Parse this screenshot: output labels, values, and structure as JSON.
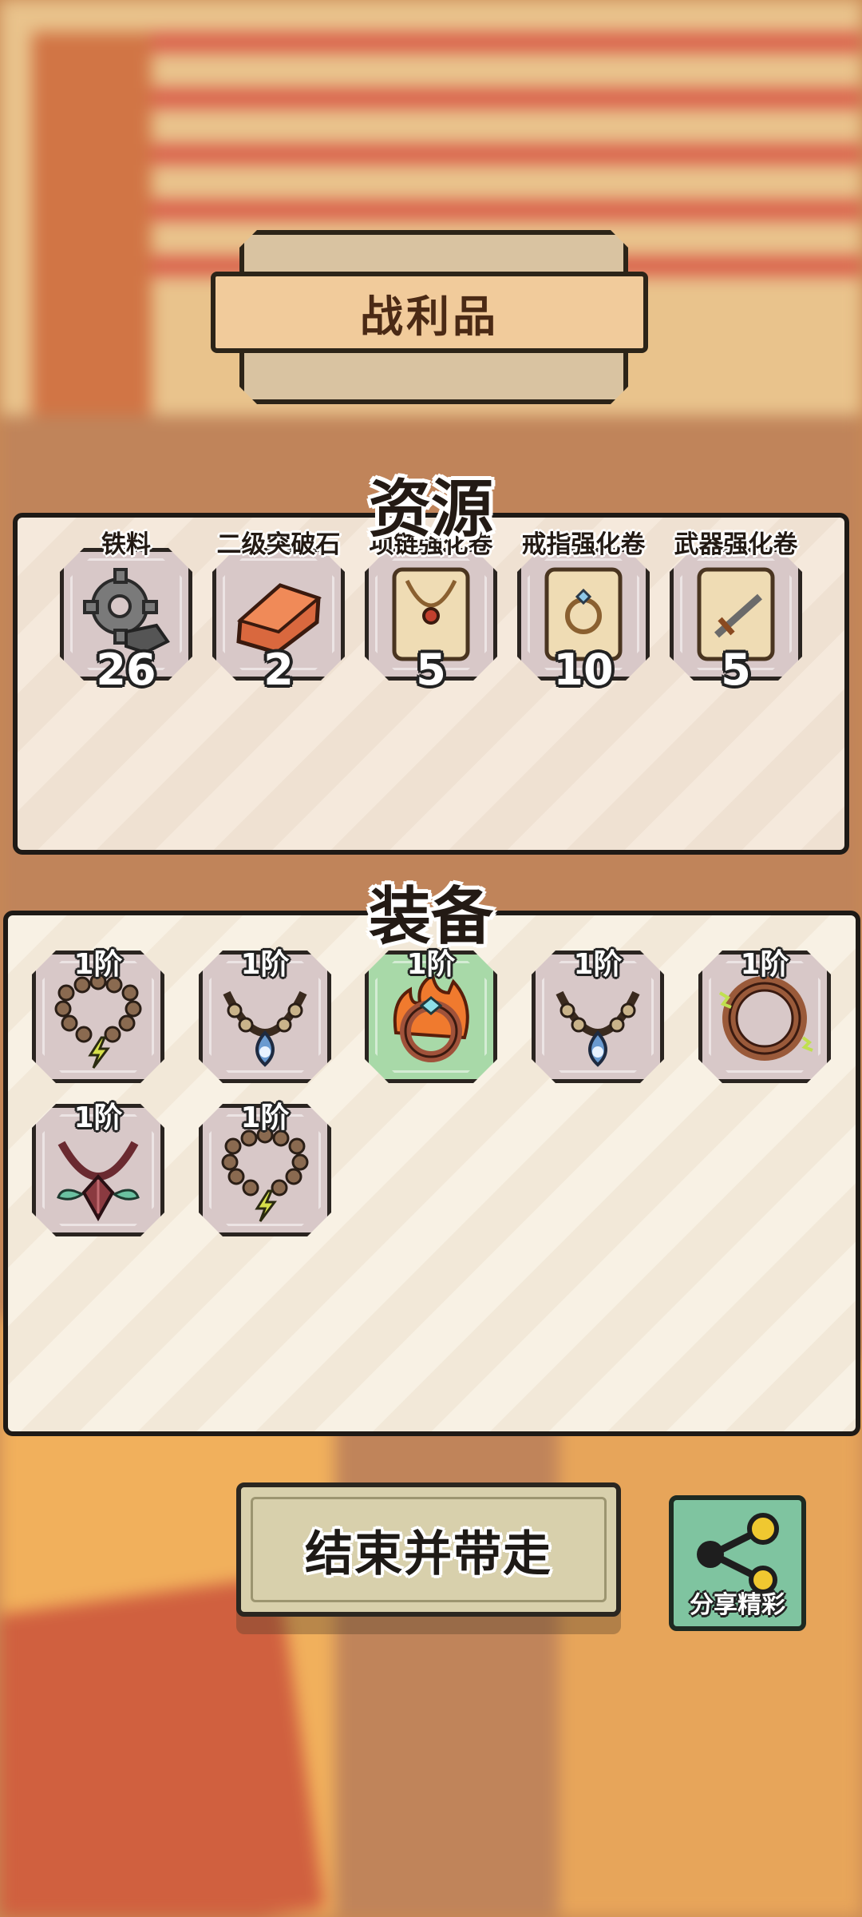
{
  "banner": {
    "title": "战利品"
  },
  "resources": {
    "heading": "资源",
    "items": [
      {
        "name": "铁料",
        "count": "26",
        "icon": "gear-ore-icon"
      },
      {
        "name": "二级突破石",
        "count": "2",
        "icon": "copper-ingot-icon"
      },
      {
        "name": "项链强化卷",
        "count": "5",
        "icon": "necklace-scroll-icon"
      },
      {
        "name": "戒指强化卷",
        "count": "10",
        "icon": "ring-scroll-icon"
      },
      {
        "name": "武器强化卷",
        "count": "5",
        "icon": "weapon-scroll-icon"
      }
    ]
  },
  "equipment": {
    "heading": "装备",
    "items": [
      {
        "tier": "1阶",
        "icon": "bead-necklace-lightning-icon",
        "rarity": "common"
      },
      {
        "tier": "1阶",
        "icon": "blue-pendant-necklace-icon",
        "rarity": "common"
      },
      {
        "tier": "1阶",
        "icon": "fire-ring-icon",
        "rarity": "uncommon"
      },
      {
        "tier": "1阶",
        "icon": "blue-pendant-necklace-icon",
        "rarity": "common"
      },
      {
        "tier": "1阶",
        "icon": "lightning-bangle-icon",
        "rarity": "common"
      },
      {
        "tier": "1阶",
        "icon": "red-gem-necklace-icon",
        "rarity": "common"
      },
      {
        "tier": "1阶",
        "icon": "bead-necklace-lightning-icon",
        "rarity": "common"
      }
    ]
  },
  "buttons": {
    "end_label": "结束并带走",
    "share_label": "分享精彩"
  },
  "colors": {
    "tile_common": "#d8c8c8",
    "tile_uncommon": "#a8d9a8",
    "banner": "#f1cb9b",
    "share": "#7fc4a0"
  }
}
